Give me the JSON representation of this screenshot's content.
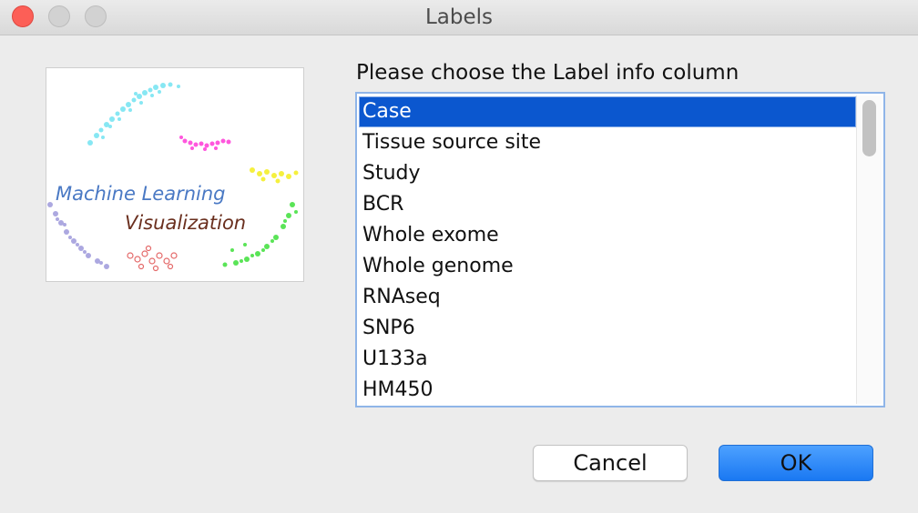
{
  "window": {
    "title": "Labels"
  },
  "logo": {
    "line1": "Machine Learning",
    "line2": "Visualization"
  },
  "prompt": "Please choose the Label info column",
  "list": {
    "selected_index": 0,
    "items": [
      "Case",
      "Tissue source site",
      "Study",
      "BCR",
      "Whole exome",
      "Whole genome",
      "RNAseq",
      "SNP6",
      "U133a",
      "HM450"
    ]
  },
  "buttons": {
    "cancel": "Cancel",
    "ok": "OK"
  },
  "colors": {
    "selection": "#0b57cf",
    "ok_button": "#1a78f2",
    "close_button": "#fc5f57"
  }
}
